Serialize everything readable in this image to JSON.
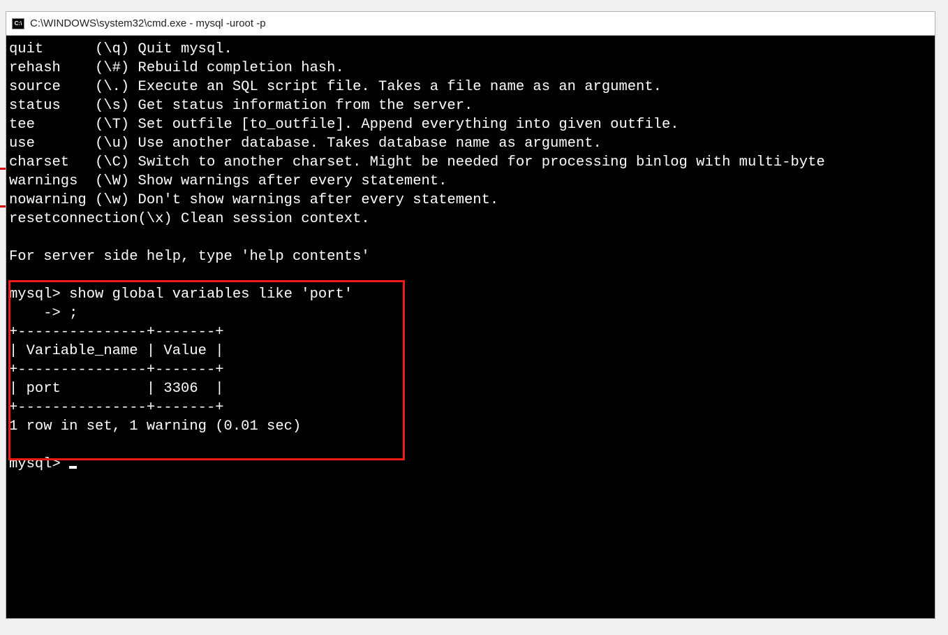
{
  "titlebar": {
    "icon_label": "C:\\",
    "text": "C:\\WINDOWS\\system32\\cmd.exe - mysql  -uroot -p"
  },
  "help": {
    "lines": [
      "quit      (\\q) Quit mysql.",
      "rehash    (\\#) Rebuild completion hash.",
      "source    (\\.) Execute an SQL script file. Takes a file name as an argument.",
      "status    (\\s) Get status information from the server.",
      "tee       (\\T) Set outfile [to_outfile]. Append everything into given outfile.",
      "use       (\\u) Use another database. Takes database name as argument.",
      "charset   (\\C) Switch to another charset. Might be needed for processing binlog with multi-byte",
      "warnings  (\\W) Show warnings after every statement.",
      "nowarning (\\w) Don't show warnings after every statement.",
      "resetconnection(\\x) Clean session context."
    ],
    "server_help": "For server side help, type 'help contents'"
  },
  "query": {
    "prompt1": "mysql> show global variables like 'port'",
    "prompt2": "    -> ;",
    "border_top": "+---------------+-------+",
    "header_row": "| Variable_name | Value |",
    "border_mid": "+---------------+-------+",
    "data_row": "| port          | 3306  |",
    "border_bot": "+---------------+-------+",
    "result_footer": "1 row in set, 1 warning (0.01 sec)"
  },
  "prompt": {
    "text": "mysql> "
  },
  "chart_data": {
    "type": "table",
    "columns": [
      "Variable_name",
      "Value"
    ],
    "rows": [
      {
        "Variable_name": "port",
        "Value": 3306
      }
    ],
    "footer": {
      "rows_in_set": 1,
      "warnings": 1,
      "seconds": 0.01
    }
  }
}
